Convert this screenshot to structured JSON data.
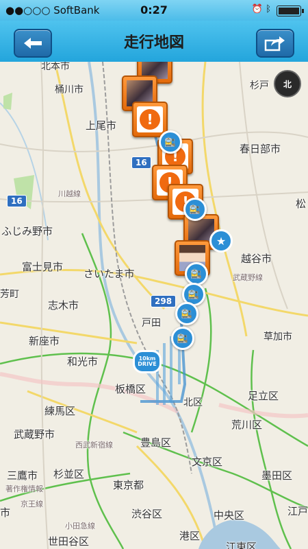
{
  "status_bar": {
    "carrier": "●●○○○ SoftBank",
    "time": "0:27",
    "icons": "⏰ ᛒ"
  },
  "nav": {
    "title": "走行地図"
  },
  "map": {
    "compass_label": "北",
    "route_shield": "298",
    "highway_shield": "16",
    "copyright": "著作権情報",
    "places": {
      "kitamoto": "北本市",
      "okegawa": "桶川市",
      "ageo": "上尾市",
      "sugito": "杉戸",
      "kasukabe": "春日部市",
      "kawagoe_line": "川越線",
      "fujimino": "ふじみ野市",
      "fujimi": "富士見市",
      "saitama": "さいたま市",
      "koshigaya": "越谷市",
      "musashino_line": "武蔵野線",
      "yoshikawa_partial": "芳町",
      "shiki": "志木市",
      "toda_partial": "戸田",
      "niiza": "新座市",
      "kusaka_partial": "草加市",
      "wako": "和光市",
      "itabashi": "板橋区",
      "adachi": "足立区",
      "kita_partial": "北区",
      "nerima": "練馬区",
      "arakawa": "荒川区",
      "musashino": "武蔵野市",
      "seibu_line": "西武新宿線",
      "toshima": "豊島区",
      "bunkyo": "文京区",
      "sumida": "墨田区",
      "mitaka": "三鷹市",
      "suginami": "杉並区",
      "tokyo": "東京都",
      "keio_line": "京王線",
      "shibuya": "渋谷区",
      "chuo": "中央区",
      "koto_partial": "江戸",
      "setagaya": "世田谷区",
      "minato_partial": "港区",
      "odakyu_line": "小田急線",
      "fuchu_partial": "市",
      "matsu_partial": "松",
      "koto_bottom": "江東区",
      "hikari_partial": "光"
    }
  },
  "pins": [
    {
      "kind": "photo"
    },
    {
      "kind": "photo"
    },
    {
      "kind": "alert",
      "glyph": "!"
    },
    {
      "kind": "alert",
      "glyph": "!"
    },
    {
      "kind": "alert",
      "glyph": "!"
    },
    {
      "kind": "alert",
      "glyph": "!"
    },
    {
      "kind": "face"
    }
  ],
  "drive_badge": "10km DRIVE",
  "colors": {
    "nav": "#23a5dc",
    "accent_orange": "#e36a0a",
    "route_blue": "#2c8fd6",
    "road_green": "#5fc04d",
    "road_yellow": "#f3d86a"
  }
}
